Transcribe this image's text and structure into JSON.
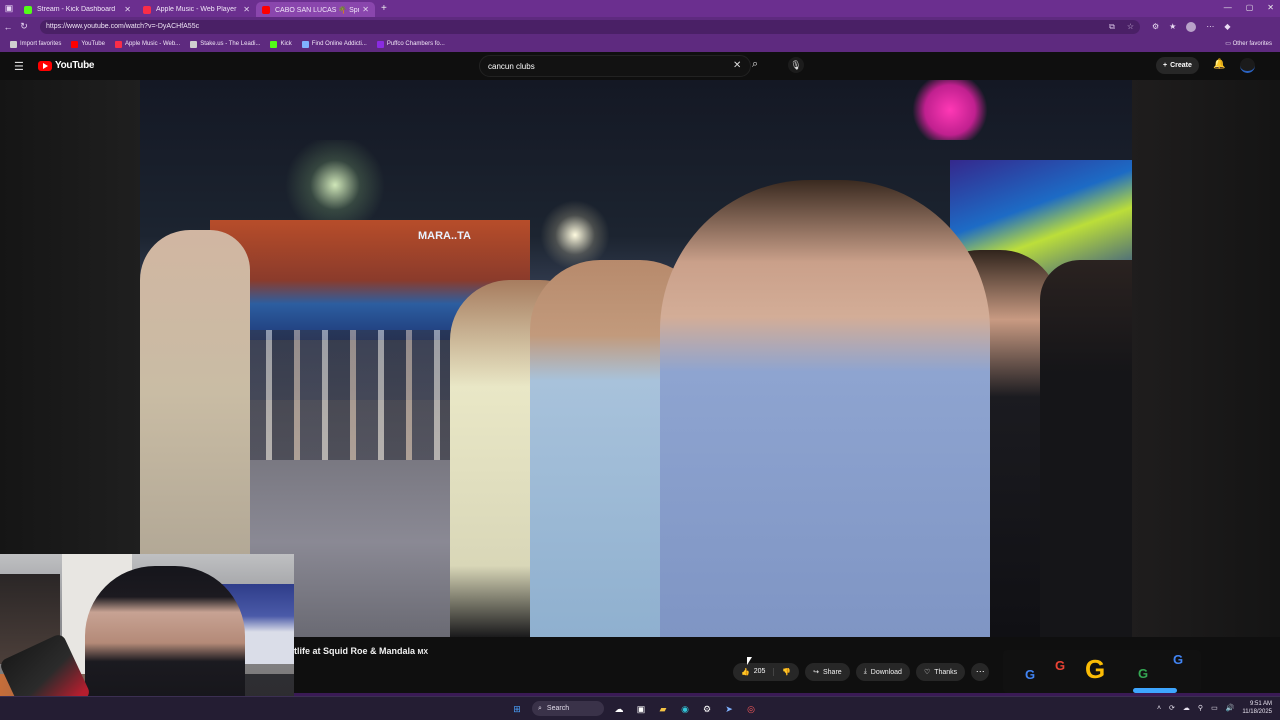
{
  "browser": {
    "tabs": [
      {
        "title": "Stream - Kick Dashboard",
        "favicon_color": "#53fc18"
      },
      {
        "title": "Apple Music - Web Player",
        "favicon_color": "#fa2d48"
      },
      {
        "title": "CABO SAN LUCAS 🌴 Spring",
        "favicon_color": "#ff0000"
      }
    ],
    "url": "https://www.youtube.com/watch?v=-DyACHfA55c",
    "favorites": [
      {
        "label": "Import favorites",
        "color": "#cfcfcf"
      },
      {
        "label": "YouTube",
        "color": "#ff0000"
      },
      {
        "label": "Apple Music - Web...",
        "color": "#fa2d48"
      },
      {
        "label": "Stake.us - The Leadi...",
        "color": "#cfcfcf"
      },
      {
        "label": "Kick",
        "color": "#53fc18"
      },
      {
        "label": "Find Online Addicti...",
        "color": "#7fb0ff"
      },
      {
        "label": "Puffco Chambers fo...",
        "color": "#8a2be2"
      }
    ],
    "other_favorites": "Other favorites"
  },
  "youtube": {
    "logo_text": "YouTube",
    "search_value": "cancun clubs",
    "create_label": "Create",
    "video_title_visible": "tlife at Squid Roe & Mandala",
    "video_title_suffix": "MX",
    "like_count": "205",
    "share_label": "Share",
    "download_label": "Download",
    "thanks_label": "Thanks"
  },
  "video_scene": {
    "sign_text": "MARA..TA"
  },
  "taskbar": {
    "search_label": "Search",
    "time": "9:51 AM",
    "date": "11/18/2025"
  }
}
